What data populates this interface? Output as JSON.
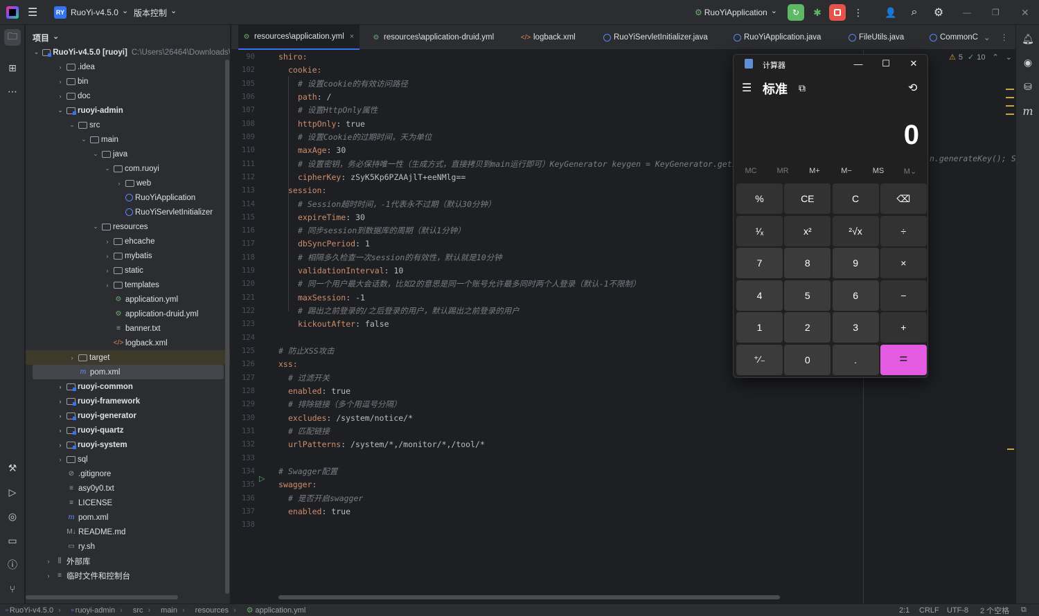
{
  "titlebar": {
    "project_badge": "RY",
    "project_name": "RuoYi-v4.5.0",
    "vcs": "版本控制",
    "run_config": "RuoYiApplication"
  },
  "project_panel": {
    "title": "项目",
    "root_name": "RuoYi-v4.5.0 [ruoyi]",
    "root_path": "C:\\Users\\26464\\Downloads\\",
    "items": [
      {
        "label": ".idea",
        "depth": 1,
        "kind": "folder",
        "arrow": "›"
      },
      {
        "label": "bin",
        "depth": 1,
        "kind": "folder",
        "arrow": "›"
      },
      {
        "label": "doc",
        "depth": 1,
        "kind": "folder",
        "arrow": "›"
      },
      {
        "label": "ruoyi-admin",
        "depth": 1,
        "kind": "module",
        "arrow": "⌄",
        "bold": true
      },
      {
        "label": "src",
        "depth": 2,
        "kind": "folder",
        "arrow": "⌄"
      },
      {
        "label": "main",
        "depth": 3,
        "kind": "folder",
        "arrow": "⌄"
      },
      {
        "label": "java",
        "depth": 4,
        "kind": "folder",
        "arrow": "⌄"
      },
      {
        "label": "com.ruoyi",
        "depth": 5,
        "kind": "folder",
        "arrow": "⌄"
      },
      {
        "label": "web",
        "depth": 6,
        "kind": "folder",
        "arrow": "›"
      },
      {
        "label": "RuoYiApplication",
        "depth": 6,
        "kind": "java",
        "arrow": ""
      },
      {
        "label": "RuoYiServletInitializer",
        "depth": 6,
        "kind": "java",
        "arrow": ""
      },
      {
        "label": "resources",
        "depth": 4,
        "kind": "folder",
        "arrow": "⌄"
      },
      {
        "label": "ehcache",
        "depth": 5,
        "kind": "folder",
        "arrow": "›"
      },
      {
        "label": "mybatis",
        "depth": 5,
        "kind": "folder",
        "arrow": "›"
      },
      {
        "label": "static",
        "depth": 5,
        "kind": "folder",
        "arrow": "›"
      },
      {
        "label": "templates",
        "depth": 5,
        "kind": "folder",
        "arrow": "›"
      },
      {
        "label": "application.yml",
        "depth": 5,
        "kind": "yml",
        "arrow": ""
      },
      {
        "label": "application-druid.yml",
        "depth": 5,
        "kind": "yml",
        "arrow": ""
      },
      {
        "label": "banner.txt",
        "depth": 5,
        "kind": "txt",
        "arrow": ""
      },
      {
        "label": "logback.xml",
        "depth": 5,
        "kind": "xml",
        "arrow": ""
      },
      {
        "label": "target",
        "depth": 2,
        "kind": "folder",
        "arrow": "›",
        "highlight": true
      },
      {
        "label": "pom.xml",
        "depth": 2,
        "kind": "maven",
        "arrow": "",
        "selected": true
      },
      {
        "label": "ruoyi-common",
        "depth": 1,
        "kind": "module",
        "arrow": "›",
        "bold": true
      },
      {
        "label": "ruoyi-framework",
        "depth": 1,
        "kind": "module",
        "arrow": "›",
        "bold": true
      },
      {
        "label": "ruoyi-generator",
        "depth": 1,
        "kind": "module",
        "arrow": "›",
        "bold": true
      },
      {
        "label": "ruoyi-quartz",
        "depth": 1,
        "kind": "module",
        "arrow": "›",
        "bold": true
      },
      {
        "label": "ruoyi-system",
        "depth": 1,
        "kind": "module",
        "arrow": "›",
        "bold": true
      },
      {
        "label": "sql",
        "depth": 1,
        "kind": "folder",
        "arrow": "›"
      },
      {
        "label": ".gitignore",
        "depth": 1,
        "kind": "ignore",
        "arrow": ""
      },
      {
        "label": "asy0y0.txt",
        "depth": 1,
        "kind": "txt",
        "arrow": ""
      },
      {
        "label": "LICENSE",
        "depth": 1,
        "kind": "txt",
        "arrow": ""
      },
      {
        "label": "pom.xml",
        "depth": 1,
        "kind": "maven",
        "arrow": ""
      },
      {
        "label": "README.md",
        "depth": 1,
        "kind": "md",
        "arrow": ""
      },
      {
        "label": "ry.sh",
        "depth": 1,
        "kind": "sh",
        "arrow": ""
      },
      {
        "label": "外部库",
        "depth": 0,
        "kind": "lib",
        "arrow": "›"
      },
      {
        "label": "临时文件和控制台",
        "depth": 0,
        "kind": "scratch",
        "arrow": "›"
      }
    ]
  },
  "tabs": [
    {
      "label": "resources\\application.yml",
      "kind": "yml",
      "active": true,
      "close": "×"
    },
    {
      "label": "resources\\application-druid.yml",
      "kind": "yml"
    },
    {
      "label": "logback.xml",
      "kind": "xml"
    },
    {
      "label": "RuoYiServletInitializer.java",
      "kind": "java"
    },
    {
      "label": "RuoYiApplication.java",
      "kind": "javarun"
    },
    {
      "label": "FileUtils.java",
      "kind": "java"
    },
    {
      "label": "CommonC",
      "kind": "java"
    }
  ],
  "inspections": {
    "warnings": "5",
    "checks": "10"
  },
  "editor": {
    "lines": [
      {
        "n": "90",
        "indent": 0,
        "parts": [
          [
            "k",
            "shiro:"
          ]
        ]
      },
      {
        "n": "102",
        "indent": 1,
        "parts": [
          [
            "k",
            "cookie:"
          ]
        ]
      },
      {
        "n": "105",
        "indent": 2,
        "parts": [
          [
            "c",
            "# 设置cookie的有效访问路径"
          ]
        ]
      },
      {
        "n": "106",
        "indent": 2,
        "parts": [
          [
            "k",
            "path"
          ],
          [
            "v",
            ": /"
          ]
        ]
      },
      {
        "n": "107",
        "indent": 2,
        "parts": [
          [
            "c",
            "# 设置HttpOnly属性"
          ]
        ]
      },
      {
        "n": "108",
        "indent": 2,
        "parts": [
          [
            "k",
            "httpOnly"
          ],
          [
            "v",
            ": true"
          ]
        ]
      },
      {
        "n": "109",
        "indent": 2,
        "parts": [
          [
            "c",
            "# 设置Cookie的过期时间，天为单位"
          ]
        ]
      },
      {
        "n": "110",
        "indent": 2,
        "parts": [
          [
            "k",
            "maxAge"
          ],
          [
            "v",
            ": 30"
          ]
        ]
      },
      {
        "n": "111",
        "indent": 2,
        "parts": [
          [
            "c",
            "# 设置密钥，务必保持唯一性（生成方式，直接拷贝到main运行即可）KeyGenerator keygen = KeyGenerator.getI"
          ]
        ]
      },
      {
        "n": "112",
        "indent": 2,
        "parts": [
          [
            "k",
            "cipherKey"
          ],
          [
            "v",
            ": zSyK5Kp6PZAAjlT+eeNMlg=="
          ]
        ]
      },
      {
        "n": "113",
        "indent": 1,
        "parts": [
          [
            "k",
            "session:"
          ]
        ]
      },
      {
        "n": "114",
        "indent": 2,
        "parts": [
          [
            "c",
            "# Session超时时间，-1代表永不过期（默认30分钟）"
          ]
        ]
      },
      {
        "n": "115",
        "indent": 2,
        "parts": [
          [
            "k",
            "expireTime"
          ],
          [
            "v",
            ": 30"
          ]
        ]
      },
      {
        "n": "116",
        "indent": 2,
        "parts": [
          [
            "c",
            "# 同步session到数据库的周期（默认1分钟）"
          ]
        ]
      },
      {
        "n": "117",
        "indent": 2,
        "parts": [
          [
            "k",
            "dbSyncPeriod"
          ],
          [
            "v",
            ": 1"
          ]
        ]
      },
      {
        "n": "118",
        "indent": 2,
        "parts": [
          [
            "c",
            "# 相隔多久检查一次session的有效性，默认就是10分钟"
          ]
        ]
      },
      {
        "n": "119",
        "indent": 2,
        "parts": [
          [
            "k",
            "validationInterval"
          ],
          [
            "v",
            ": 10"
          ]
        ]
      },
      {
        "n": "120",
        "indent": 2,
        "parts": [
          [
            "c",
            "# 同一个用户最大会话数，比如2的意思是同一个账号允许最多同时两个人登录（默认-1不限制）"
          ]
        ]
      },
      {
        "n": "121",
        "indent": 2,
        "parts": [
          [
            "k",
            "maxSession"
          ],
          [
            "v",
            ": -1"
          ]
        ]
      },
      {
        "n": "122",
        "indent": 2,
        "parts": [
          [
            "c",
            "# 踢出之前登录的/之后登录的用户，默认踢出之前登录的用户"
          ]
        ]
      },
      {
        "n": "123",
        "indent": 2,
        "parts": [
          [
            "k",
            "kickoutAfter"
          ],
          [
            "v",
            ": false"
          ]
        ]
      },
      {
        "n": "124",
        "indent": 0,
        "parts": []
      },
      {
        "n": "125",
        "indent": 0,
        "parts": [
          [
            "c",
            "# 防止XSS攻击"
          ]
        ]
      },
      {
        "n": "126",
        "indent": 0,
        "parts": [
          [
            "k",
            "xss:"
          ]
        ]
      },
      {
        "n": "127",
        "indent": 1,
        "parts": [
          [
            "c",
            "# 过滤开关"
          ]
        ]
      },
      {
        "n": "128",
        "indent": 1,
        "parts": [
          [
            "k",
            "enabled"
          ],
          [
            "v",
            ": true"
          ]
        ]
      },
      {
        "n": "129",
        "indent": 1,
        "parts": [
          [
            "c",
            "# 排除链接（多个用逗号分隔）"
          ]
        ]
      },
      {
        "n": "130",
        "indent": 1,
        "parts": [
          [
            "k",
            "excludes"
          ],
          [
            "v",
            ": /system/notice/*"
          ]
        ]
      },
      {
        "n": "131",
        "indent": 1,
        "parts": [
          [
            "c",
            "# 匹配链接"
          ]
        ]
      },
      {
        "n": "132",
        "indent": 1,
        "parts": [
          [
            "k",
            "urlPatterns"
          ],
          [
            "v",
            ": /system/*,/monitor/*,/tool/*"
          ]
        ]
      },
      {
        "n": "133",
        "indent": 0,
        "parts": []
      },
      {
        "n": "134",
        "indent": 0,
        "parts": [
          [
            "c",
            "# Swagger配置"
          ]
        ]
      },
      {
        "n": "135",
        "indent": 0,
        "parts": [
          [
            "k",
            "swagger:"
          ]
        ]
      },
      {
        "n": "136",
        "indent": 1,
        "parts": [
          [
            "c",
            "# 是否开启swagger"
          ]
        ]
      },
      {
        "n": "137",
        "indent": 1,
        "parts": [
          [
            "k",
            "enabled"
          ],
          [
            "v",
            ": true"
          ]
        ]
      },
      {
        "n": "138",
        "indent": 0,
        "parts": []
      }
    ],
    "overflow_tail": "n.generateKey(); S"
  },
  "calculator": {
    "title": "计算器",
    "mode": "标准",
    "display": "0",
    "memory": [
      "MC",
      "MR",
      "M+",
      "M−",
      "MS",
      "M⌄"
    ],
    "keys": [
      [
        "%",
        "CE",
        "C",
        "⌫"
      ],
      [
        "¹⁄ₓ",
        "x²",
        "²√x",
        "÷"
      ],
      [
        "7",
        "8",
        "9",
        "×"
      ],
      [
        "4",
        "5",
        "6",
        "−"
      ],
      [
        "1",
        "2",
        "3",
        "+"
      ],
      [
        "⁺⁄₋",
        "0",
        ".",
        "="
      ]
    ]
  },
  "statusbar": {
    "crumbs": [
      "RuoYi-v4.5.0",
      "ruoyi-admin",
      "src",
      "main",
      "resources",
      "application.yml"
    ],
    "position": "2:1",
    "line_sep": "CRLF",
    "encoding": "UTF-8",
    "indent": "2 个空格"
  }
}
